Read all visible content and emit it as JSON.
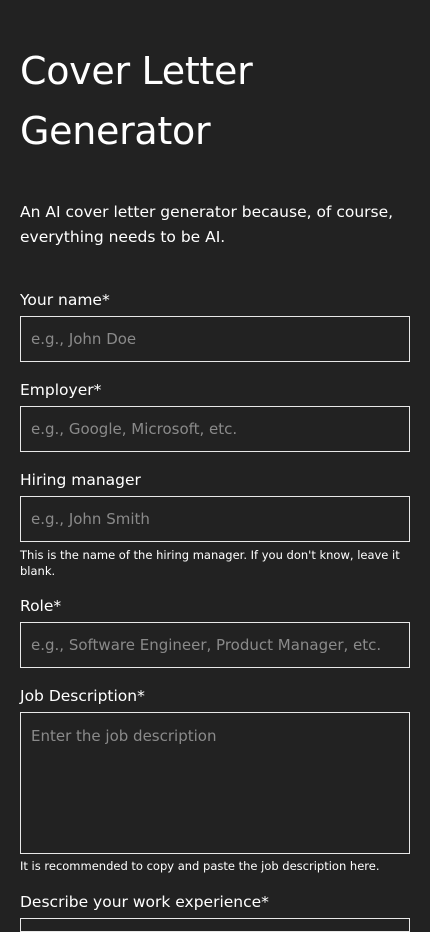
{
  "header": {
    "title": "Cover Letter Generator",
    "subtitle": "An AI cover letter generator because, of course, everything needs to be AI."
  },
  "form": {
    "name": {
      "label": "Your name*",
      "placeholder": "e.g., John Doe"
    },
    "employer": {
      "label": "Employer*",
      "placeholder": "e.g., Google, Microsoft, etc."
    },
    "hiring_manager": {
      "label": "Hiring manager",
      "placeholder": "e.g., John Smith",
      "help": "This is the name of the hiring manager. If you don't know, leave it blank."
    },
    "role": {
      "label": "Role*",
      "placeholder": "e.g., Software Engineer, Product Manager, etc."
    },
    "job_description": {
      "label": "Job Description*",
      "placeholder": "Enter the job description",
      "help": "It is recommended to copy and paste the job description here."
    },
    "work_experience": {
      "label": "Describe your work experience*"
    }
  },
  "colors": {
    "background": "#222222",
    "text": "#ffffff",
    "border": "#e8e8e8",
    "placeholder": "#8a8a8a"
  }
}
